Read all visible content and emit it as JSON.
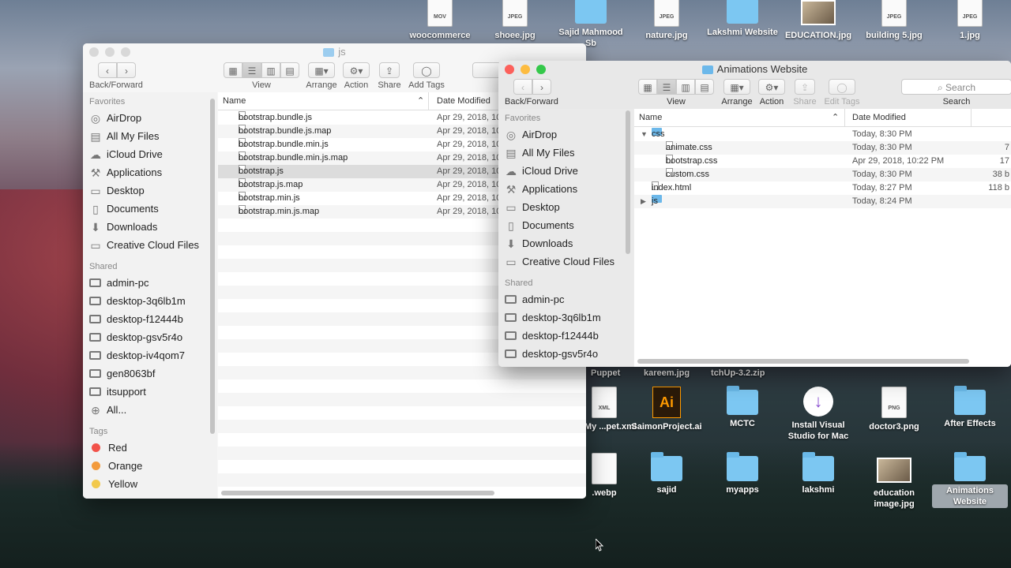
{
  "desktop": {
    "top_icons": [
      {
        "label": "woocommerce",
        "type": "file",
        "kind": "MOV"
      },
      {
        "label": "shoee.jpg",
        "type": "file",
        "kind": "JPEG"
      },
      {
        "label": "Sajid Mahmood Sb",
        "type": "folder"
      },
      {
        "label": "nature.jpg",
        "type": "file",
        "kind": "JPEG"
      },
      {
        "label": "Lakshmi Website",
        "type": "folder"
      },
      {
        "label": "EDUCATION.jpg",
        "type": "image"
      },
      {
        "label": "building 5.jpg",
        "type": "file",
        "kind": "JPEG"
      },
      {
        "label": "1.jpg",
        "type": "file",
        "kind": "JPEG"
      }
    ],
    "partial_labels": [
      "Puppet",
      "kareem.jpg",
      "tchUp-3.2.zip"
    ],
    "row2_icons": [
      {
        "label": "e - My ...pet.xml",
        "type": "file",
        "kind": "XML"
      },
      {
        "label": "SaimonProject.ai",
        "type": "ai",
        "glyph": "Ai"
      },
      {
        "label": "MCTC",
        "type": "folder"
      },
      {
        "label": "Install Visual Studio for Mac",
        "type": "vs",
        "glyph": "↓"
      },
      {
        "label": "doctor3.png",
        "type": "file",
        "kind": "PNG"
      },
      {
        "label": "After Effects",
        "type": "folder"
      }
    ],
    "row3_icons": [
      {
        "label": ".webp",
        "type": "file",
        "kind": ""
      },
      {
        "label": "sajid",
        "type": "folder"
      },
      {
        "label": "myapps",
        "type": "folder"
      },
      {
        "label": "lakshmi",
        "type": "folder"
      },
      {
        "label": "education image.jpg",
        "type": "image"
      },
      {
        "label": "Animations Website",
        "type": "folder",
        "selected": true
      }
    ]
  },
  "win_js": {
    "title": "js",
    "toolbar": {
      "back_forward": "Back/Forward",
      "view": "View",
      "arrange": "Arrange",
      "action": "Action",
      "share": "Share",
      "add_tags": "Add Tags"
    },
    "sidebar": {
      "favorites_head": "Favorites",
      "favorites": [
        "AirDrop",
        "All My Files",
        "iCloud Drive",
        "Applications",
        "Desktop",
        "Documents",
        "Downloads",
        "Creative Cloud Files"
      ],
      "shared_head": "Shared",
      "shared": [
        "admin-pc",
        "desktop-3q6lb1m",
        "desktop-f12444b",
        "desktop-gsv5r4o",
        "desktop-iv4qom7",
        "gen8063bf",
        "itsupport",
        "All..."
      ],
      "tags_head": "Tags",
      "tags": [
        {
          "name": "Red",
          "color": "#f2524a"
        },
        {
          "name": "Orange",
          "color": "#f39a3b"
        },
        {
          "name": "Yellow",
          "color": "#f2c94c"
        }
      ]
    },
    "columns": {
      "name": "Name",
      "date": "Date Modified"
    },
    "files": [
      {
        "name": "bootstrap.bundle.js",
        "date": "Apr 29, 2018, 10"
      },
      {
        "name": "bootstrap.bundle.js.map",
        "date": "Apr 29, 2018, 10"
      },
      {
        "name": "bootstrap.bundle.min.js",
        "date": "Apr 29, 2018, 10"
      },
      {
        "name": "bootstrap.bundle.min.js.map",
        "date": "Apr 29, 2018, 10"
      },
      {
        "name": "bootstrap.js",
        "date": "Apr 29, 2018, 10",
        "selected": true
      },
      {
        "name": "bootstrap.js.map",
        "date": "Apr 29, 2018, 10"
      },
      {
        "name": "bootstrap.min.js",
        "date": "Apr 29, 2018, 10"
      },
      {
        "name": "bootstrap.min.js.map",
        "date": "Apr 29, 2018, 10"
      }
    ]
  },
  "win_anim": {
    "title": "Animations Website",
    "toolbar": {
      "back_forward": "Back/Forward",
      "view": "View",
      "arrange": "Arrange",
      "action": "Action",
      "share": "Share",
      "edit_tags": "Edit Tags",
      "search_placeholder": "Search",
      "search_label": "Search"
    },
    "sidebar": {
      "favorites_head": "Favorites",
      "favorites": [
        "AirDrop",
        "All My Files",
        "iCloud Drive",
        "Applications",
        "Desktop",
        "Documents",
        "Downloads",
        "Creative Cloud Files"
      ],
      "shared_head": "Shared",
      "shared": [
        "admin-pc",
        "desktop-3q6lb1m",
        "desktop-f12444b",
        "desktop-gsv5r4o"
      ]
    },
    "columns": {
      "name": "Name",
      "date": "Date Modified"
    },
    "files": [
      {
        "name": "css",
        "date": "Today, 8:30 PM",
        "size": "",
        "type": "folder",
        "level": 0,
        "expanded": true
      },
      {
        "name": "animate.css",
        "date": "Today, 8:30 PM",
        "size": "7",
        "type": "file",
        "level": 1
      },
      {
        "name": "bootstrap.css",
        "date": "Apr 29, 2018, 10:22 PM",
        "size": "17",
        "type": "file",
        "level": 1
      },
      {
        "name": "custom.css",
        "date": "Today, 8:30 PM",
        "size": "38 b",
        "type": "file",
        "level": 1
      },
      {
        "name": "index.html",
        "date": "Today, 8:27 PM",
        "size": "118 b",
        "type": "file",
        "level": 0
      },
      {
        "name": "js",
        "date": "Today, 8:24 PM",
        "size": "",
        "type": "folder",
        "level": 0,
        "expanded": false
      }
    ]
  }
}
